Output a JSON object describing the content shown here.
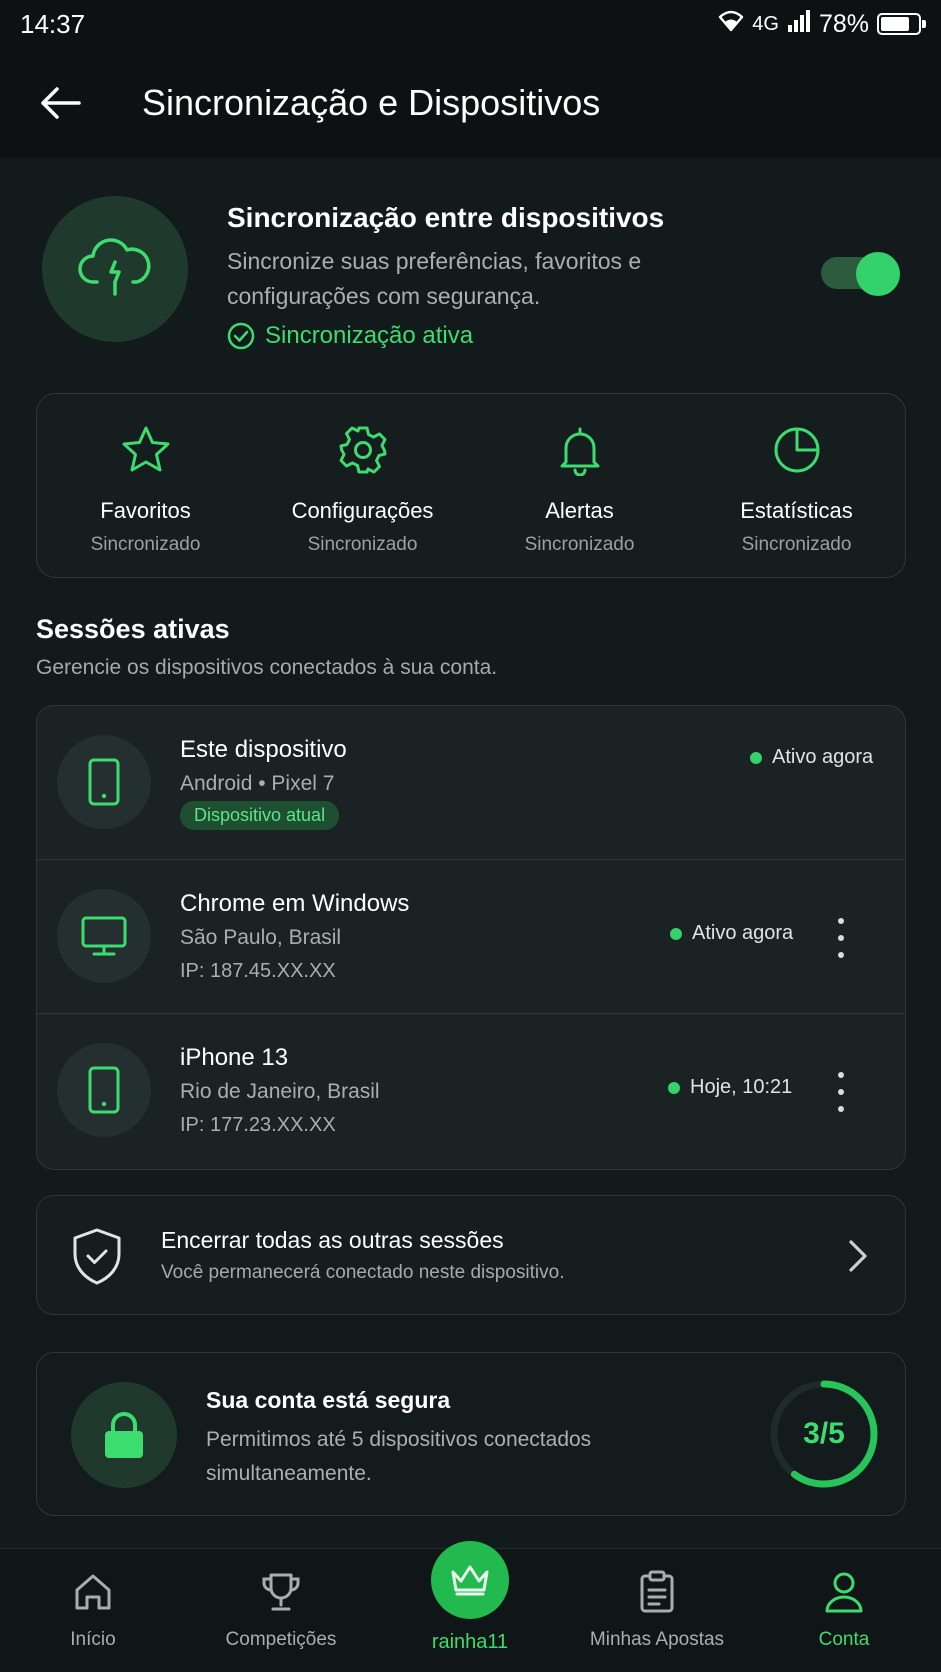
{
  "status_bar": {
    "time": "14:37",
    "network": "4G",
    "battery": "78%",
    "battery_level": 0.78
  },
  "app_bar": {
    "title": "Sincronização e Dispositivos"
  },
  "sync": {
    "title": "Sincronização entre dispositivos",
    "description": "Sincronize suas preferências, favoritos e configurações com segurança.",
    "status": "Sincronização ativa",
    "enabled": true
  },
  "categories": [
    {
      "name": "Favoritos",
      "status": "Sincronizado",
      "icon": "star-icon"
    },
    {
      "name": "Configurações",
      "status": "Sincronizado",
      "icon": "gear-icon"
    },
    {
      "name": "Alertas",
      "status": "Sincronizado",
      "icon": "bell-icon"
    },
    {
      "name": "Estatísticas",
      "status": "Sincronizado",
      "icon": "pie-chart-icon"
    }
  ],
  "sessions": {
    "title": "Sessões ativas",
    "subtitle": "Gerencie os dispositivos conectados à sua conta.",
    "items": [
      {
        "name": "Este dispositivo",
        "line1": "Android • Pixel 7",
        "badge": "Dispositivo atual",
        "status": "Ativo agora",
        "icon": "smartphone-icon"
      },
      {
        "name": "Chrome em Windows",
        "line1": "São Paulo, Brasil",
        "line2": "IP: 187.45.XX.XX",
        "status": "Ativo agora",
        "icon": "monitor-icon"
      },
      {
        "name": "iPhone 13",
        "line1": "Rio de Janeiro, Brasil",
        "line2": "IP: 177.23.XX.XX",
        "status": "Hoje, 10:21",
        "icon": "smartphone-icon"
      }
    ]
  },
  "end_sessions": {
    "title": "Encerrar todas as outras sessões",
    "subtitle": "Você permanecerá conectado neste dispositivo."
  },
  "security": {
    "title": "Sua conta está segura",
    "description": "Permitimos até 5 dispositivos conectados simultaneamente.",
    "usage_label": "3/5",
    "used": 3,
    "max": 5
  },
  "nav": {
    "items": [
      {
        "label": "Início",
        "icon": "home-icon"
      },
      {
        "label": "Competições",
        "icon": "trophy-icon"
      },
      {
        "label": "rainha11",
        "icon": "crown-icon"
      },
      {
        "label": "Minhas Apostas",
        "icon": "clipboard-icon"
      },
      {
        "label": "Conta",
        "icon": "user-icon",
        "active": true
      }
    ]
  },
  "colors": {
    "accent": "#34d26a",
    "background": "#121a1b",
    "card": "#1a2223"
  }
}
